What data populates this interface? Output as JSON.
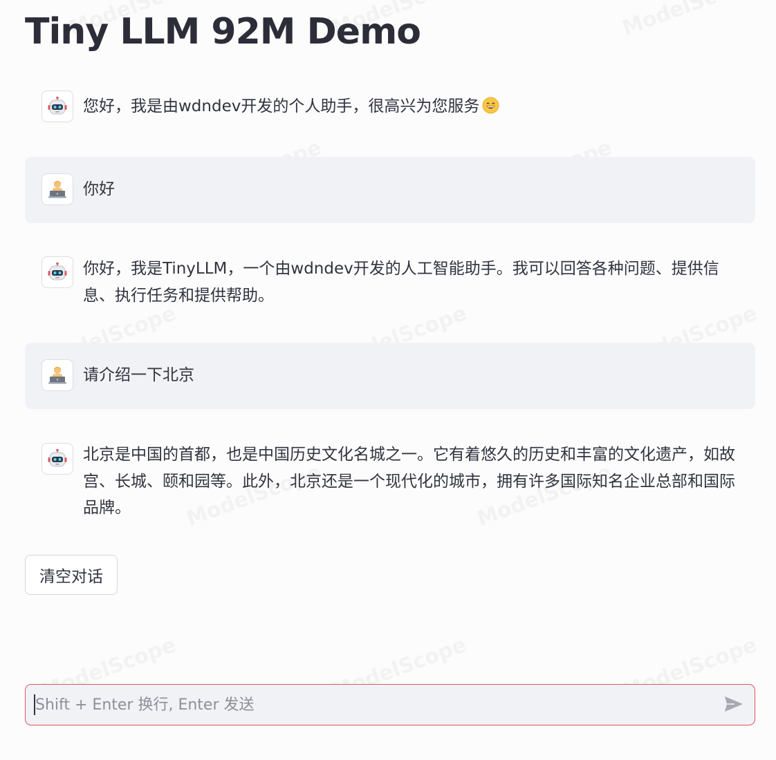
{
  "title": "Tiny LLM 92M Demo",
  "messages": [
    {
      "role": "assistant",
      "text": "您好，我是由wdndev开发的个人助手，很高兴为您服务",
      "emoji": "grinning-face"
    },
    {
      "role": "user",
      "text": "你好"
    },
    {
      "role": "assistant",
      "text": "你好，我是TinyLLM，一个由wdndev开发的人工智能助手。我可以回答各种问题、提供信息、执行任务和提供帮助。"
    },
    {
      "role": "user",
      "text": "请介绍一下北京"
    },
    {
      "role": "assistant",
      "text": "北京是中国的首都，也是中国历史文化名城之一。它有着悠久的历史和丰富的文化遗产，如故宫、长城、颐和园等。此外，北京还是一个现代化的城市，拥有许多国际知名企业总部和国际品牌。"
    }
  ],
  "clear_button": {
    "label": "清空对话"
  },
  "chat_input": {
    "value": "",
    "placeholder": "Shift + Enter 换行, Enter 发送"
  },
  "watermark": {
    "text": "ModelScope"
  },
  "icons": {
    "assistant_avatar": "robot-icon",
    "user_avatar": "person-at-laptop-icon",
    "send": "send-icon"
  },
  "colors": {
    "input_border": "#e0565d",
    "user_bubble": "#f1f2f5",
    "text": "#31333f"
  }
}
